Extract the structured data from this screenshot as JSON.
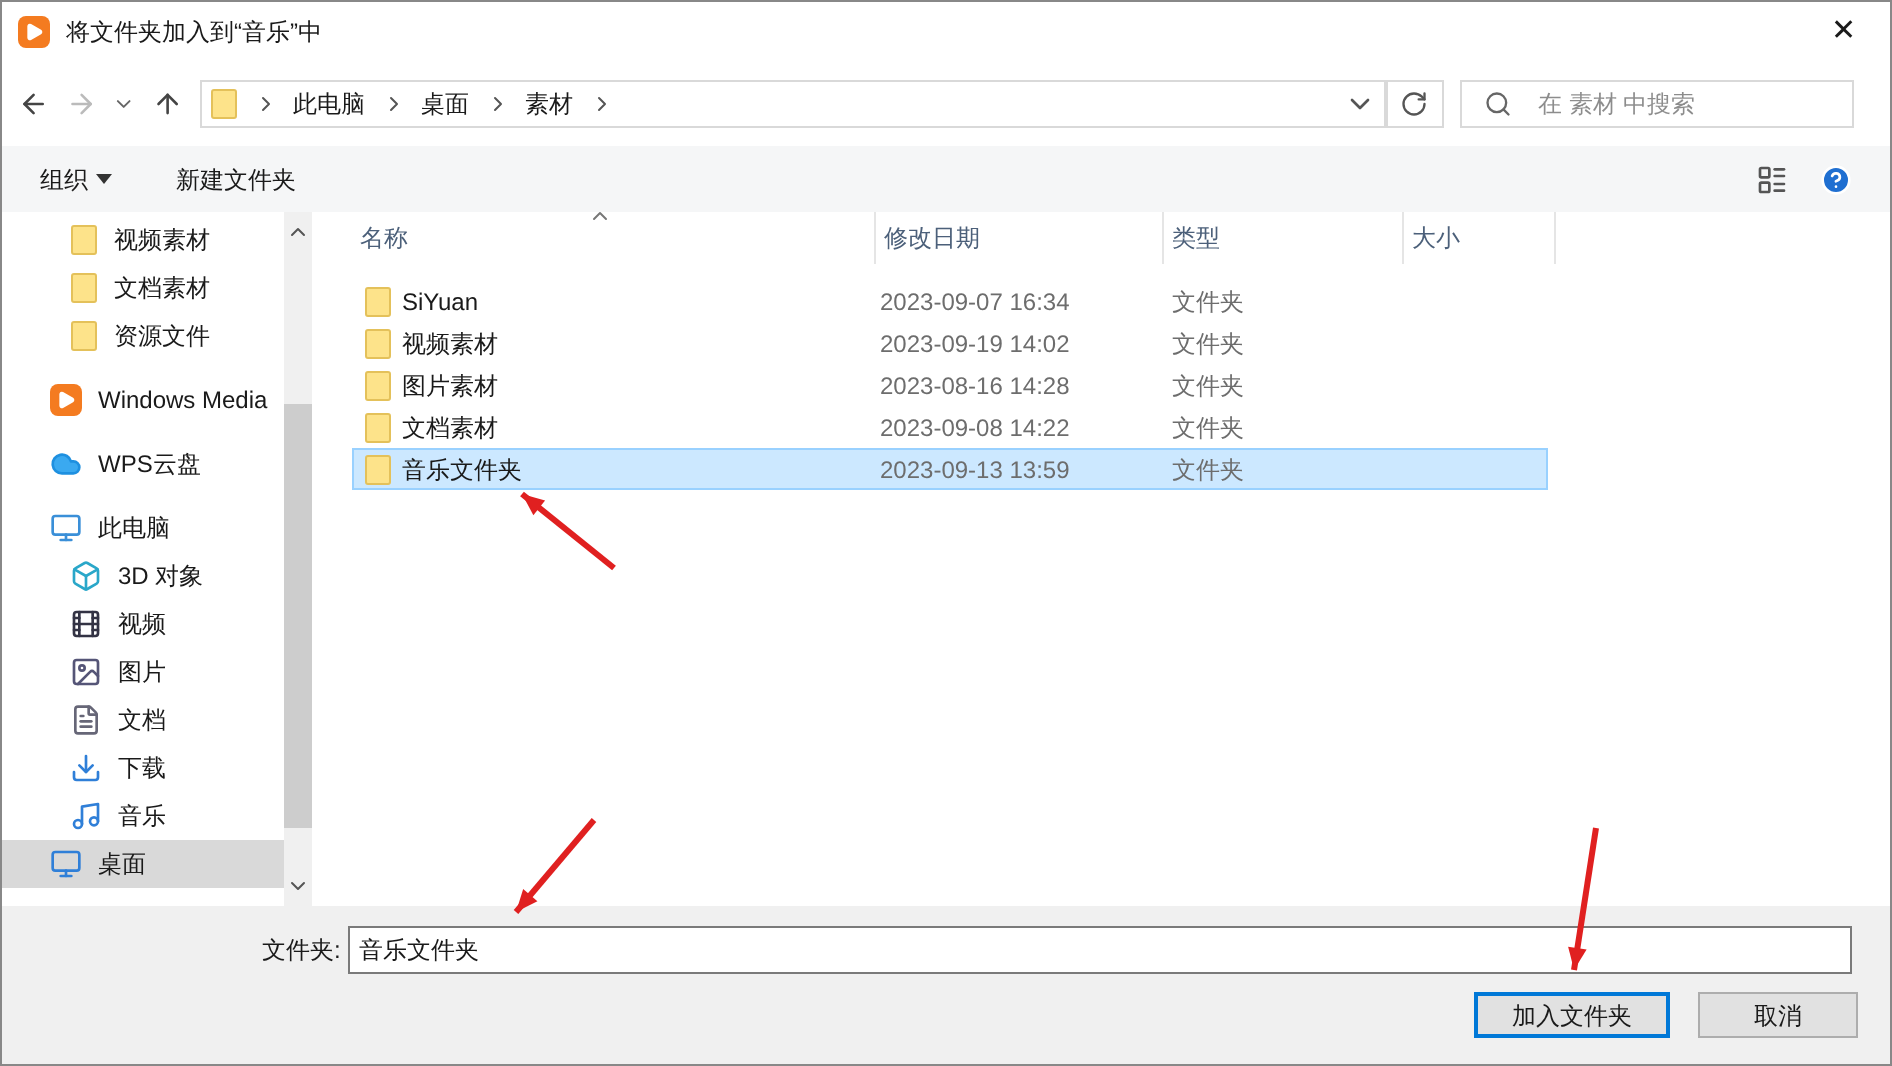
{
  "window": {
    "title": "将文件夹加入到“音乐”中",
    "close": "✕"
  },
  "address": {
    "crumbs": [
      "此电脑",
      "桌面",
      "素材"
    ],
    "search_placeholder": "在 素材 中搜索"
  },
  "toolbar": {
    "organize": "组织",
    "new_folder": "新建文件夹"
  },
  "sidebar": {
    "items": [
      {
        "label": "视频素材",
        "kind": "folder",
        "selected": false
      },
      {
        "label": "文档素材",
        "kind": "folder",
        "selected": false
      },
      {
        "label": "资源文件",
        "kind": "folder",
        "selected": false
      },
      {
        "label": "Windows Media",
        "kind": "media",
        "selected": false
      },
      {
        "label": "WPS云盘",
        "kind": "cloud",
        "selected": false
      },
      {
        "label": "此电脑",
        "kind": "pc",
        "selected": false
      },
      {
        "label": "3D 对象",
        "kind": "cube",
        "selected": false
      },
      {
        "label": "视频",
        "kind": "video",
        "selected": false
      },
      {
        "label": "图片",
        "kind": "picture",
        "selected": false
      },
      {
        "label": "文档",
        "kind": "document",
        "selected": false
      },
      {
        "label": "下载",
        "kind": "download",
        "selected": false
      },
      {
        "label": "音乐",
        "kind": "music",
        "selected": false
      },
      {
        "label": "桌面",
        "kind": "desktop",
        "selected": true
      }
    ]
  },
  "table": {
    "columns": [
      "名称",
      "修改日期",
      "类型",
      "大小"
    ],
    "rows": [
      {
        "name": "SiYuan",
        "date": "2023-09-07 16:34",
        "type": "文件夹",
        "selected": false
      },
      {
        "name": "视频素材",
        "date": "2023-09-19 14:02",
        "type": "文件夹",
        "selected": false
      },
      {
        "name": "图片素材",
        "date": "2023-08-16 14:28",
        "type": "文件夹",
        "selected": false
      },
      {
        "name": "文档素材",
        "date": "2023-09-08 14:22",
        "type": "文件夹",
        "selected": false
      },
      {
        "name": "音乐文件夹",
        "date": "2023-09-13 13:59",
        "type": "文件夹",
        "selected": true
      }
    ]
  },
  "footer": {
    "label": "文件夹:",
    "value": "音乐文件夹",
    "ok": "加入文件夹",
    "cancel": "取消"
  }
}
